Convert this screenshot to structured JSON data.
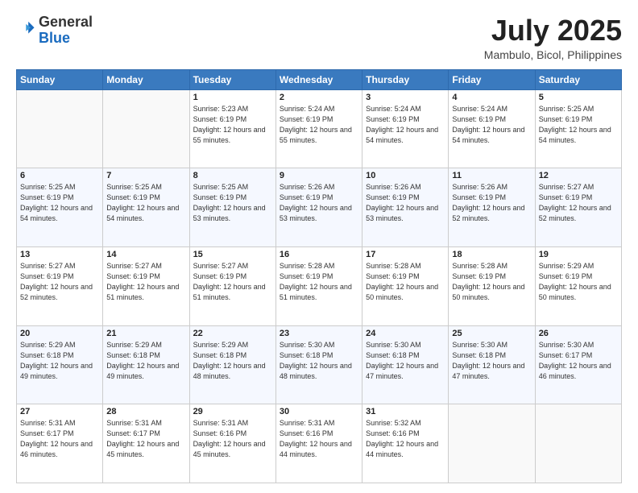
{
  "header": {
    "logo_general": "General",
    "logo_blue": "Blue",
    "month_title": "July 2025",
    "location": "Mambulo, Bicol, Philippines"
  },
  "days_of_week": [
    "Sunday",
    "Monday",
    "Tuesday",
    "Wednesday",
    "Thursday",
    "Friday",
    "Saturday"
  ],
  "weeks": [
    [
      {
        "day": "",
        "sunrise": "",
        "sunset": "",
        "daylight": ""
      },
      {
        "day": "",
        "sunrise": "",
        "sunset": "",
        "daylight": ""
      },
      {
        "day": "1",
        "sunrise": "Sunrise: 5:23 AM",
        "sunset": "Sunset: 6:19 PM",
        "daylight": "Daylight: 12 hours and 55 minutes."
      },
      {
        "day": "2",
        "sunrise": "Sunrise: 5:24 AM",
        "sunset": "Sunset: 6:19 PM",
        "daylight": "Daylight: 12 hours and 55 minutes."
      },
      {
        "day": "3",
        "sunrise": "Sunrise: 5:24 AM",
        "sunset": "Sunset: 6:19 PM",
        "daylight": "Daylight: 12 hours and 54 minutes."
      },
      {
        "day": "4",
        "sunrise": "Sunrise: 5:24 AM",
        "sunset": "Sunset: 6:19 PM",
        "daylight": "Daylight: 12 hours and 54 minutes."
      },
      {
        "day": "5",
        "sunrise": "Sunrise: 5:25 AM",
        "sunset": "Sunset: 6:19 PM",
        "daylight": "Daylight: 12 hours and 54 minutes."
      }
    ],
    [
      {
        "day": "6",
        "sunrise": "Sunrise: 5:25 AM",
        "sunset": "Sunset: 6:19 PM",
        "daylight": "Daylight: 12 hours and 54 minutes."
      },
      {
        "day": "7",
        "sunrise": "Sunrise: 5:25 AM",
        "sunset": "Sunset: 6:19 PM",
        "daylight": "Daylight: 12 hours and 54 minutes."
      },
      {
        "day": "8",
        "sunrise": "Sunrise: 5:25 AM",
        "sunset": "Sunset: 6:19 PM",
        "daylight": "Daylight: 12 hours and 53 minutes."
      },
      {
        "day": "9",
        "sunrise": "Sunrise: 5:26 AM",
        "sunset": "Sunset: 6:19 PM",
        "daylight": "Daylight: 12 hours and 53 minutes."
      },
      {
        "day": "10",
        "sunrise": "Sunrise: 5:26 AM",
        "sunset": "Sunset: 6:19 PM",
        "daylight": "Daylight: 12 hours and 53 minutes."
      },
      {
        "day": "11",
        "sunrise": "Sunrise: 5:26 AM",
        "sunset": "Sunset: 6:19 PM",
        "daylight": "Daylight: 12 hours and 52 minutes."
      },
      {
        "day": "12",
        "sunrise": "Sunrise: 5:27 AM",
        "sunset": "Sunset: 6:19 PM",
        "daylight": "Daylight: 12 hours and 52 minutes."
      }
    ],
    [
      {
        "day": "13",
        "sunrise": "Sunrise: 5:27 AM",
        "sunset": "Sunset: 6:19 PM",
        "daylight": "Daylight: 12 hours and 52 minutes."
      },
      {
        "day": "14",
        "sunrise": "Sunrise: 5:27 AM",
        "sunset": "Sunset: 6:19 PM",
        "daylight": "Daylight: 12 hours and 51 minutes."
      },
      {
        "day": "15",
        "sunrise": "Sunrise: 5:27 AM",
        "sunset": "Sunset: 6:19 PM",
        "daylight": "Daylight: 12 hours and 51 minutes."
      },
      {
        "day": "16",
        "sunrise": "Sunrise: 5:28 AM",
        "sunset": "Sunset: 6:19 PM",
        "daylight": "Daylight: 12 hours and 51 minutes."
      },
      {
        "day": "17",
        "sunrise": "Sunrise: 5:28 AM",
        "sunset": "Sunset: 6:19 PM",
        "daylight": "Daylight: 12 hours and 50 minutes."
      },
      {
        "day": "18",
        "sunrise": "Sunrise: 5:28 AM",
        "sunset": "Sunset: 6:19 PM",
        "daylight": "Daylight: 12 hours and 50 minutes."
      },
      {
        "day": "19",
        "sunrise": "Sunrise: 5:29 AM",
        "sunset": "Sunset: 6:19 PM",
        "daylight": "Daylight: 12 hours and 50 minutes."
      }
    ],
    [
      {
        "day": "20",
        "sunrise": "Sunrise: 5:29 AM",
        "sunset": "Sunset: 6:18 PM",
        "daylight": "Daylight: 12 hours and 49 minutes."
      },
      {
        "day": "21",
        "sunrise": "Sunrise: 5:29 AM",
        "sunset": "Sunset: 6:18 PM",
        "daylight": "Daylight: 12 hours and 49 minutes."
      },
      {
        "day": "22",
        "sunrise": "Sunrise: 5:29 AM",
        "sunset": "Sunset: 6:18 PM",
        "daylight": "Daylight: 12 hours and 48 minutes."
      },
      {
        "day": "23",
        "sunrise": "Sunrise: 5:30 AM",
        "sunset": "Sunset: 6:18 PM",
        "daylight": "Daylight: 12 hours and 48 minutes."
      },
      {
        "day": "24",
        "sunrise": "Sunrise: 5:30 AM",
        "sunset": "Sunset: 6:18 PM",
        "daylight": "Daylight: 12 hours and 47 minutes."
      },
      {
        "day": "25",
        "sunrise": "Sunrise: 5:30 AM",
        "sunset": "Sunset: 6:18 PM",
        "daylight": "Daylight: 12 hours and 47 minutes."
      },
      {
        "day": "26",
        "sunrise": "Sunrise: 5:30 AM",
        "sunset": "Sunset: 6:17 PM",
        "daylight": "Daylight: 12 hours and 46 minutes."
      }
    ],
    [
      {
        "day": "27",
        "sunrise": "Sunrise: 5:31 AM",
        "sunset": "Sunset: 6:17 PM",
        "daylight": "Daylight: 12 hours and 46 minutes."
      },
      {
        "day": "28",
        "sunrise": "Sunrise: 5:31 AM",
        "sunset": "Sunset: 6:17 PM",
        "daylight": "Daylight: 12 hours and 45 minutes."
      },
      {
        "day": "29",
        "sunrise": "Sunrise: 5:31 AM",
        "sunset": "Sunset: 6:16 PM",
        "daylight": "Daylight: 12 hours and 45 minutes."
      },
      {
        "day": "30",
        "sunrise": "Sunrise: 5:31 AM",
        "sunset": "Sunset: 6:16 PM",
        "daylight": "Daylight: 12 hours and 44 minutes."
      },
      {
        "day": "31",
        "sunrise": "Sunrise: 5:32 AM",
        "sunset": "Sunset: 6:16 PM",
        "daylight": "Daylight: 12 hours and 44 minutes."
      },
      {
        "day": "",
        "sunrise": "",
        "sunset": "",
        "daylight": ""
      },
      {
        "day": "",
        "sunrise": "",
        "sunset": "",
        "daylight": ""
      }
    ]
  ]
}
